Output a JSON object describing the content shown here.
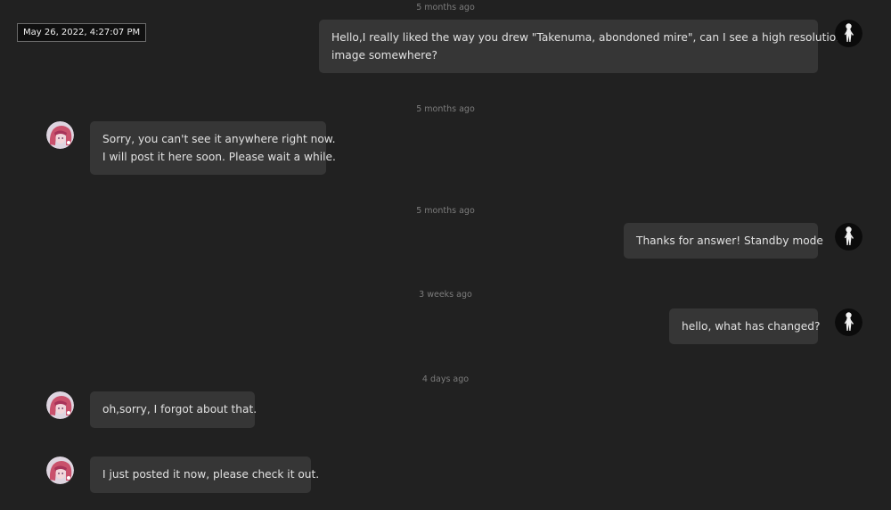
{
  "tooltip": {
    "text": "May 26, 2022, 4:27:07 PM"
  },
  "messages": [
    {
      "time": "5 months ago",
      "side": "right",
      "lines": [
        "Hello,I really liked the way you drew \"Takenuma, abondoned mire\", can I see a high resolution",
        "image somewhere?"
      ]
    },
    {
      "time": "5 months ago",
      "side": "left",
      "lines": [
        "Sorry, you can't see it anywhere right now.",
        "I will post it here soon. Please wait a while."
      ]
    },
    {
      "time": "5 months ago",
      "side": "right",
      "lines": [
        "Thanks for answer! Standby mode"
      ]
    },
    {
      "time": "3 weeks ago",
      "side": "right",
      "lines": [
        "hello, what has changed?"
      ]
    },
    {
      "time": "4 days ago",
      "side": "left",
      "lines": [
        "oh,sorry, I forgot about that."
      ]
    },
    {
      "time": "",
      "side": "left",
      "lines": [
        "I just posted it now, please check it out."
      ]
    }
  ],
  "avatars": {
    "self": "silhouette-avatar-icon",
    "other": "anime-girl-avatar-icon"
  },
  "colors": {
    "background": "#212121",
    "bubble": "#363636",
    "text": "#e1e1e1",
    "timestamp": "#7c7c7c"
  }
}
